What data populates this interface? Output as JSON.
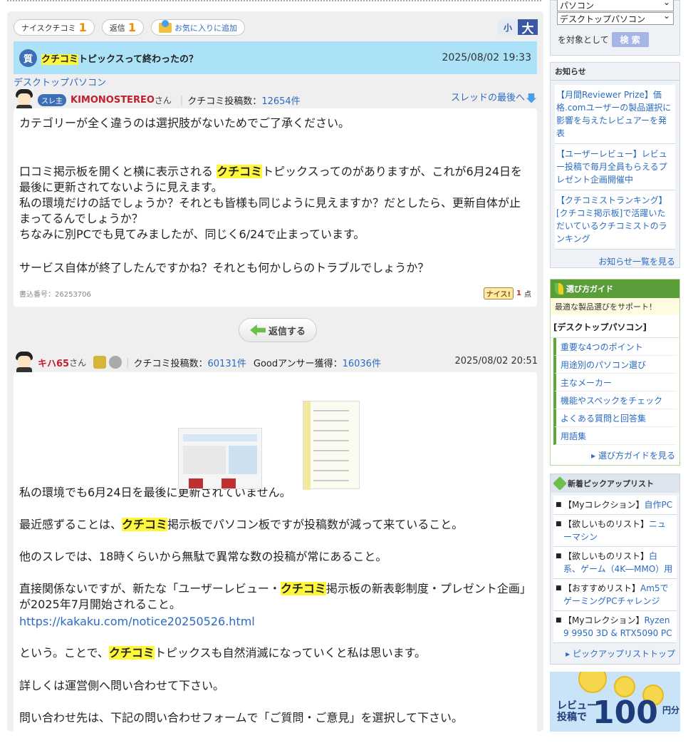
{
  "toolbar": {
    "nice_label": "ナイスクチコミ",
    "nice_count": "1",
    "reply_label": "返信",
    "reply_count": "1",
    "fav_label": "お気に入りに追加",
    "size_small": "小",
    "size_large": "大"
  },
  "thread": {
    "q_badge": "質",
    "title_hl": "クチコミ",
    "title_rest": "トピックスって終わったの？",
    "date": "2025/08/02 19:33",
    "category": "デスクトップパソコン"
  },
  "post1": {
    "badge": "スレ主",
    "username": "KIMONOSTEREO",
    "san": "さん",
    "count_label": "クチコミ投稿数：",
    "count": "12654件",
    "last_link": "スレッドの最後へ",
    "p1": "カテゴリーが全く違うのは選択肢がないためでご了承ください。",
    "p2a": "口コミ掲示板を開くと横に表示される ",
    "p2hl": "クチコミ",
    "p2b": "トピックスってのがありますが、これが6月24日を最後に更新されてないように見えます。\n私の環境だけの話でしょうか？それとも皆様も同じように見えますか？だとしたら、更新自体が止まってるんでしょうか？\nちなみに別PCでも見てみましたが、同じく6/24で止まっています。",
    "p3": "サービス自体が終了したんですかね？それとも何かしらのトラブルでしょうか？",
    "meta": "書込番号：26253706",
    "nice_btn": "ナイス!",
    "nice_pts": "1",
    "nice_unit": "点"
  },
  "reply_button": "返信する",
  "post2": {
    "username": "キハ65",
    "san": "さん",
    "count_label": "クチコミ投稿数：",
    "count": "60131件",
    "good_label": "Goodアンサー獲得：",
    "good_count": "16036件",
    "date": "2025/08/02 20:51",
    "l1": "私の環境でも6月24日を最後に更新されていません。",
    "l2a": "最近感ずることは、",
    "l2hl": "クチコミ",
    "l2b": "掲示板でパソコン板ですが投稿数が減って来ていること。",
    "l3": "他のスレでは、18時くらいから無駄で異常な数の投稿が常にあること。",
    "l4a": "直接関係ないですが、新たな「ユーザーレビュー・",
    "l4hl": "クチコミ",
    "l4b": "掲示板の新表彰制度・プレゼント企画」が2025年7月開始されること。",
    "url": "https://kakaku.com/notice20250526.html",
    "l5a": "という。ことで、",
    "l5hl": "クチコミ",
    "l5b": "トピックスも自然消滅になっていくと私は思います。",
    "l6": "詳しくは運営側へ問い合わせて下さい。",
    "l7": "問い合わせ先は、下記の問い合わせフォームで「ご質問・ご意見」を選択して下さい。"
  },
  "sidebar": {
    "select1": "パソコン",
    "select2": "デスクトップパソコン",
    "search_text": "を対象として",
    "search_btn": "検 索",
    "news_title": "お知らせ",
    "news": [
      "【月間Reviewer Prize】価格.comユーザーの製品選択に影響を与えたレビュアーを発表",
      "【ユーザーレビュー】レビュー投稿で毎月全員もらえるプレゼント企画開催中",
      "【クチコミストランキング】[クチコミ掲示板]で活躍いただいているクチコミストのランキング"
    ],
    "news_more": "お知らせ一覧を見る",
    "guide_title": "選び方ガイド",
    "guide_sub": "最適な製品選びをサポート！",
    "guide_cat": "[デスクトップパソコン]",
    "guide_links": [
      "重要な4つのポイント",
      "用途別のパソコン選び",
      "主なメーカー",
      "機能やスペックをチェック",
      "よくある質問と回答集",
      "用語集"
    ],
    "guide_more": "選び方ガイドを見る",
    "pick_title": "新着ピックアップリスト",
    "picks": [
      {
        "prefix": "【Myコレクション】",
        "link": "自作PC"
      },
      {
        "prefix": "【欲しいものリスト】",
        "link": "ニューマシン"
      },
      {
        "prefix": "【欲しいものリスト】",
        "link": "白系、ゲーム（4K―MMO）用"
      },
      {
        "prefix": "【おすすめリスト】",
        "link": "Am5でゲーミングPCチャレンジ"
      },
      {
        "prefix": "【Myコレクション】",
        "link": "Ryzen 9 9950 3D & RTX5090 PC"
      }
    ],
    "pick_more": "ピックアップリストトップ",
    "banner_a": "レビュー",
    "banner_b": "投稿で",
    "banner_num": "100",
    "banner_unit": "円分"
  }
}
